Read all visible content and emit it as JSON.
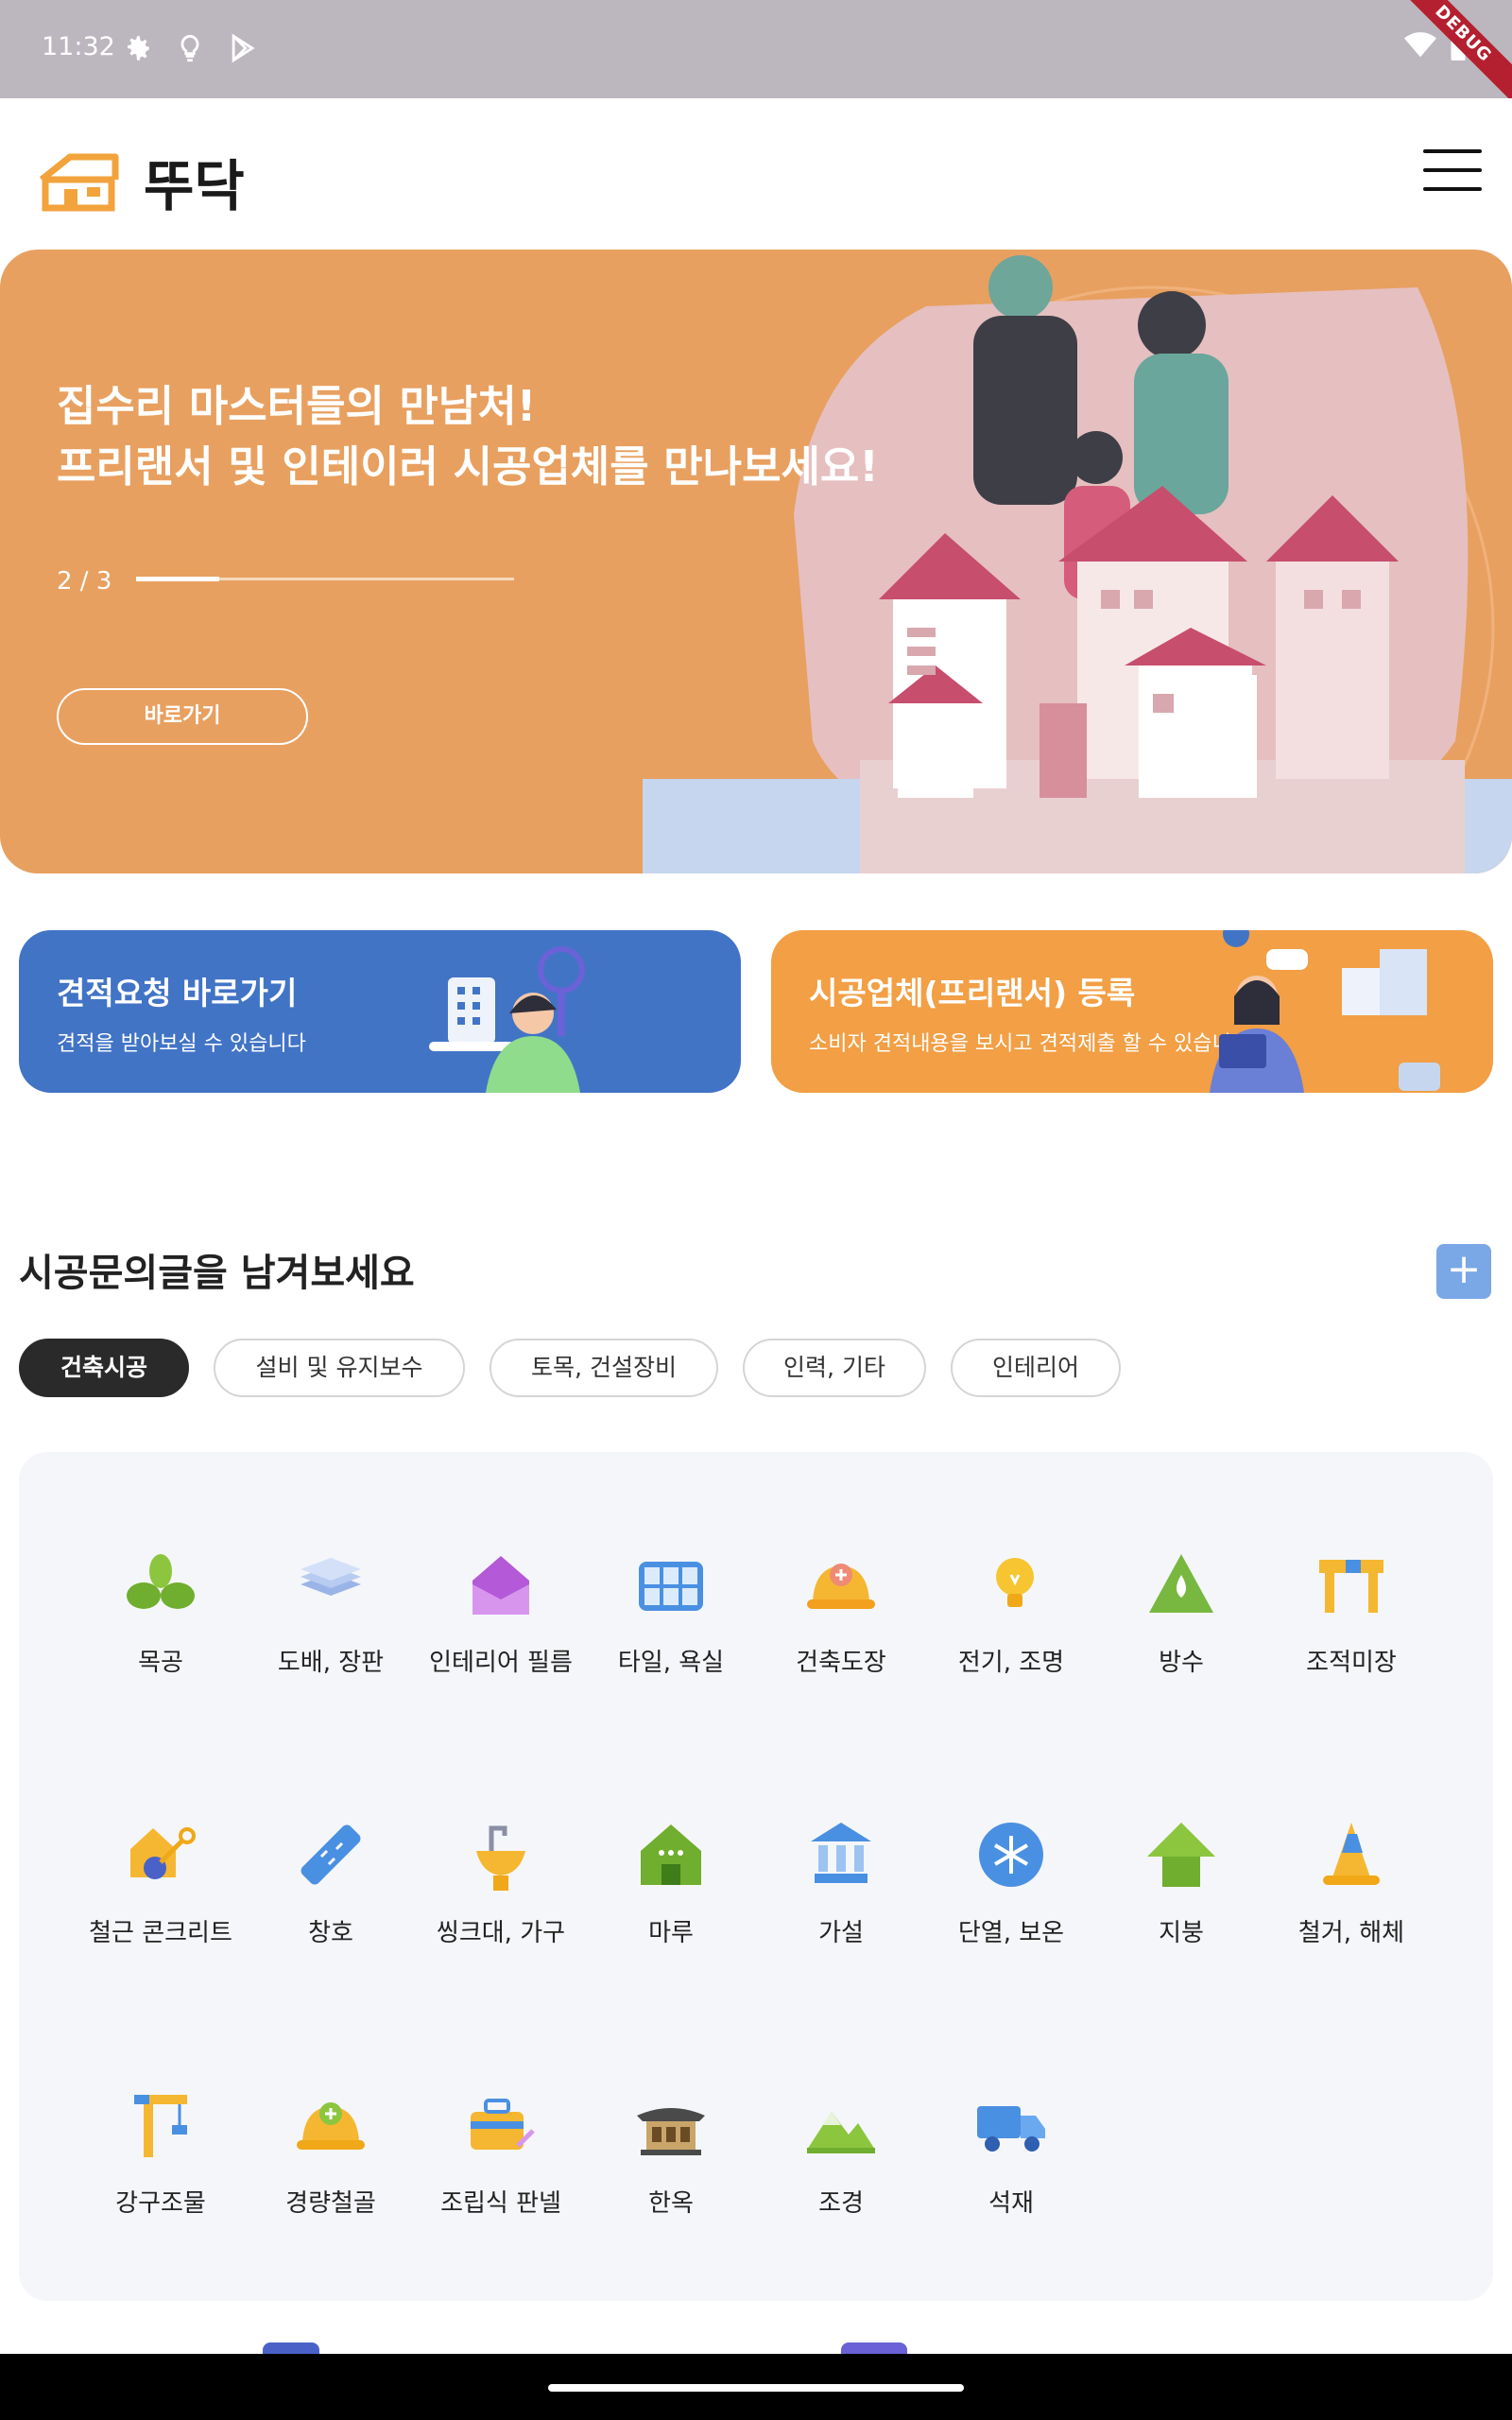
{
  "status_bar": {
    "time": "11:32",
    "debug": "DEBUG"
  },
  "app": {
    "logo_text": "뚜닥"
  },
  "banner": {
    "line1": "집수리 마스터들의 만남처!",
    "line2": "프리랜서 및 인테이러 시공업체를 만나보세요!",
    "page": "2 / 3",
    "progress": 0.22,
    "cta": "바로가기"
  },
  "promos": {
    "left": {
      "title": "견적요청 바로가기",
      "subtitle": "견적을 받아보실 수 있습니다"
    },
    "right": {
      "title": "시공업체(프리랜서) 등록",
      "subtitle": "소비자 견적내용을 보시고 견적제출 할 수 있습니다"
    }
  },
  "section": {
    "title": "시공문의글을 남겨보세요",
    "add": "+"
  },
  "chips": [
    "건축시공",
    "설비 및 유지보수",
    "토목, 건설장비",
    "인력, 기타",
    "인테리어"
  ],
  "categories": [
    {
      "label": "목공",
      "icon": "sprout-icon"
    },
    {
      "label": "도배, 장판",
      "icon": "layers-icon"
    },
    {
      "label": "인테리어 필름",
      "icon": "house-purple-icon"
    },
    {
      "label": "타일, 욕실",
      "icon": "tile-grid-icon"
    },
    {
      "label": "건축도장",
      "icon": "hardhat-plus-icon"
    },
    {
      "label": "전기, 조명",
      "icon": "lightbulb-icon"
    },
    {
      "label": "방수",
      "icon": "waterdrop-icon"
    },
    {
      "label": "조적미장",
      "icon": "table-icon"
    },
    {
      "label": "철근 콘크리트",
      "icon": "house-shovel-icon"
    },
    {
      "label": "창호",
      "icon": "ruler-icon"
    },
    {
      "label": "씽크대, 가구",
      "icon": "faucet-icon"
    },
    {
      "label": "마루",
      "icon": "green-house-icon"
    },
    {
      "label": "가설",
      "icon": "building-pillars-icon"
    },
    {
      "label": "단열, 보온",
      "icon": "snowflake-icon"
    },
    {
      "label": "지붕",
      "icon": "roof-arrow-icon"
    },
    {
      "label": "철거, 해체",
      "icon": "traffic-cone-icon"
    },
    {
      "label": "강구조물",
      "icon": "crane-icon"
    },
    {
      "label": "경량철골",
      "icon": "hardhat-green-icon"
    },
    {
      "label": "조립식 판넬",
      "icon": "toolbox-icon"
    },
    {
      "label": "한옥",
      "icon": "hanok-icon"
    },
    {
      "label": "조경",
      "icon": "mountain-icon"
    },
    {
      "label": "석재",
      "icon": "truck-icon"
    }
  ]
}
